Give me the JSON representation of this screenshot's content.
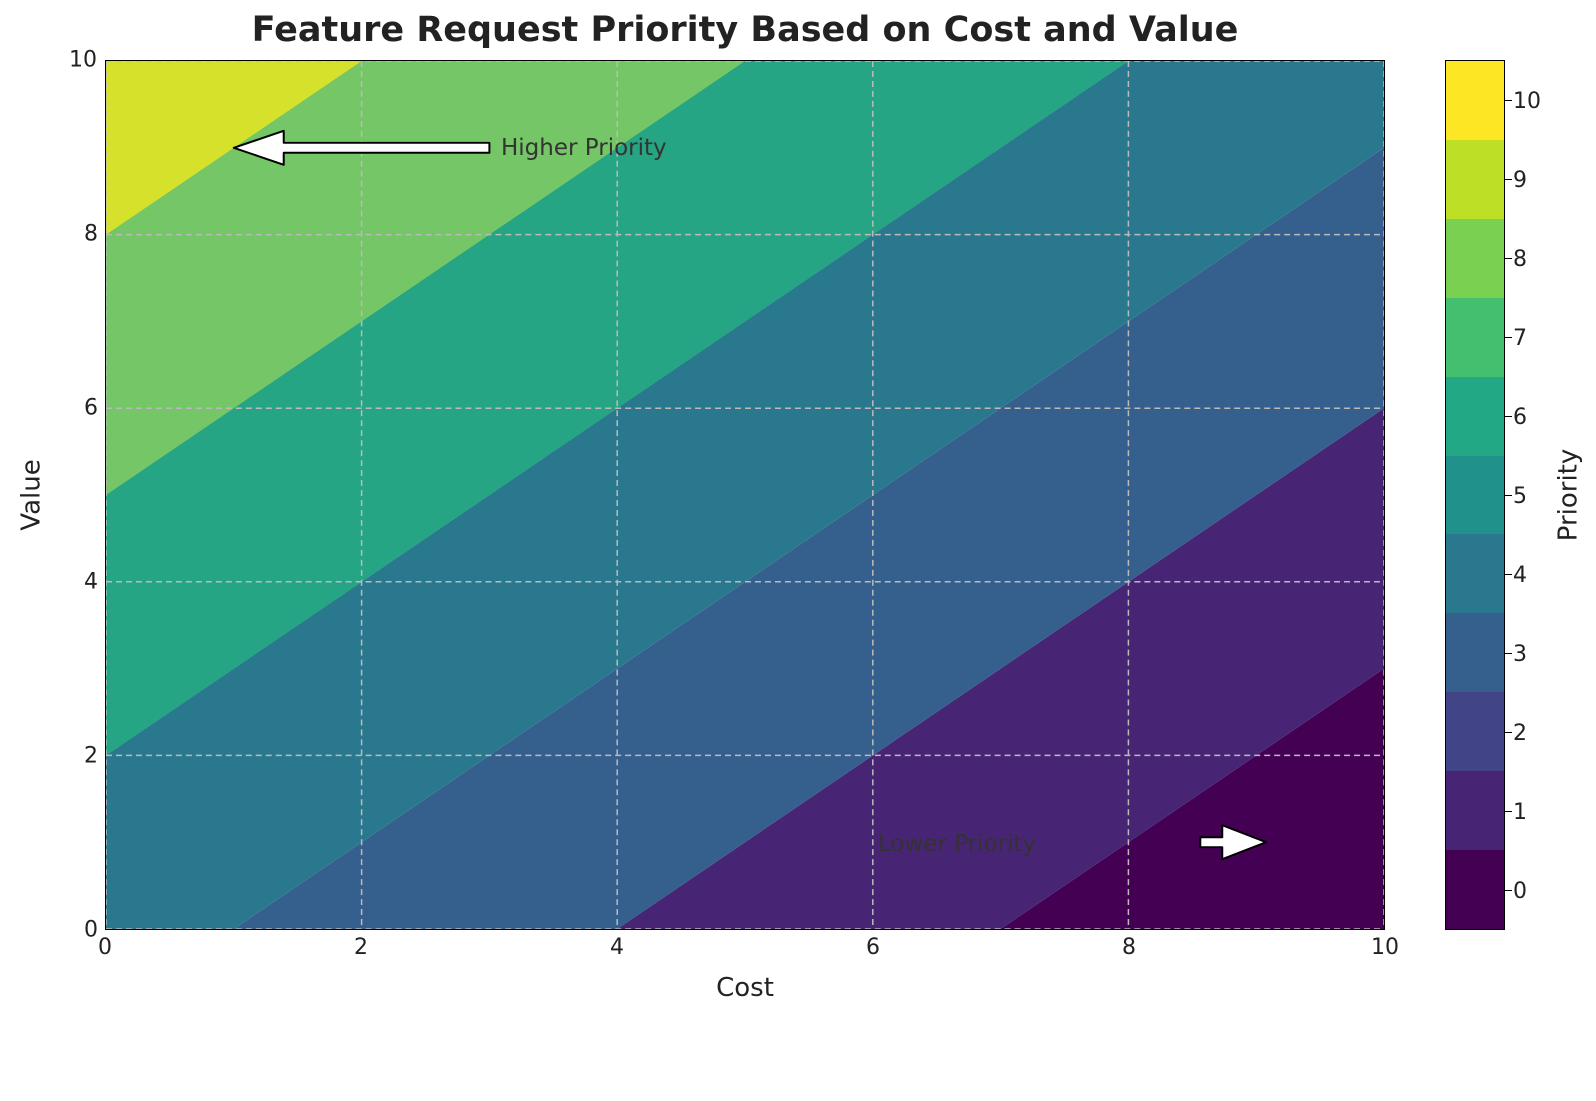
{
  "chart_data": {
    "type": "heatmap",
    "title": "Feature Request Priority Based on Cost and Value",
    "xlabel": "Cost",
    "ylabel": "Value",
    "colorbar_label": "Priority",
    "xlim": [
      0,
      10
    ],
    "ylim": [
      0,
      10
    ],
    "xticks": [
      0,
      2,
      4,
      6,
      8,
      10
    ],
    "yticks": [
      0,
      2,
      4,
      6,
      8,
      10
    ],
    "colorbar_range": [
      -0.5,
      10.5
    ],
    "colorbar_ticks": [
      0,
      1,
      2,
      3,
      4,
      5,
      6,
      7,
      8,
      9,
      10
    ],
    "priority_levels": 11,
    "priority_formula": "round(value - cost + 10) / 2 mapped to discrete 0..10 diagonal bands",
    "band_boundaries_value_intercept_at_x0": [
      2,
      5,
      8
    ],
    "annotations": [
      {
        "text": "Higher Priority",
        "x": 3.0,
        "y": 9.0,
        "arrow_to": {
          "x": 1.0,
          "y": 9.0
        }
      },
      {
        "text": "Lower Priority",
        "x": 7.0,
        "y": 1.0,
        "arrow_to": {
          "x": 9.0,
          "y": 1.0
        }
      }
    ],
    "colormap": "viridis",
    "viridis_11": [
      "#440154",
      "#482475",
      "#414487",
      "#355f8d",
      "#2a788e",
      "#21918c",
      "#22a884",
      "#44bf70",
      "#7ad151",
      "#bddf26",
      "#fde725"
    ],
    "grid": true
  }
}
